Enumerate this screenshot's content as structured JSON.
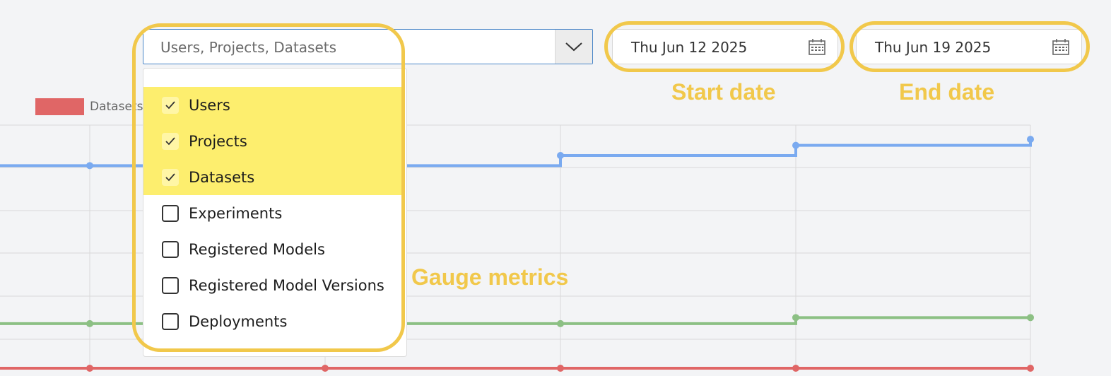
{
  "metrics_select": {
    "value": "Users, Projects, Datasets",
    "options": [
      {
        "label": "Users",
        "checked": true
      },
      {
        "label": "Projects",
        "checked": true
      },
      {
        "label": "Datasets",
        "checked": true
      },
      {
        "label": "Experiments",
        "checked": false
      },
      {
        "label": "Registered Models",
        "checked": false
      },
      {
        "label": "Registered Model Versions",
        "checked": false
      },
      {
        "label": "Deployments",
        "checked": false
      }
    ]
  },
  "start_date": {
    "value": "Thu Jun 12 2025"
  },
  "end_date": {
    "value": "Thu Jun 19 2025"
  },
  "annotations": {
    "start_date": "Start date",
    "end_date": "End date",
    "gauge_metrics": "Gauge metrics"
  },
  "colors": {
    "users_line": "#7aaaf0",
    "projects_line": "#8cc084",
    "datasets_line": "#e06666",
    "highlight": "#f1c84b",
    "selected_option": "#fdee6e"
  },
  "chart_data": {
    "type": "line",
    "step": true,
    "legend": [
      {
        "name": "Datasets",
        "color": "#e06666"
      }
    ],
    "grid": true,
    "note": "y axis labels not visible in the cropped view",
    "series": [
      {
        "id": "users",
        "color": "#7aaaf0",
        "values": [
          1.0,
          1.0,
          1.0,
          1.05,
          1.1,
          1.13
        ]
      },
      {
        "id": "projects",
        "color": "#8cc084",
        "values": [
          0.22,
          0.22,
          0.22,
          0.22,
          0.25,
          0.25
        ]
      },
      {
        "id": "datasets",
        "color": "#e06666",
        "values": [
          0.0,
          0.0,
          0.0,
          0.0,
          0.0,
          0.0
        ]
      }
    ]
  }
}
